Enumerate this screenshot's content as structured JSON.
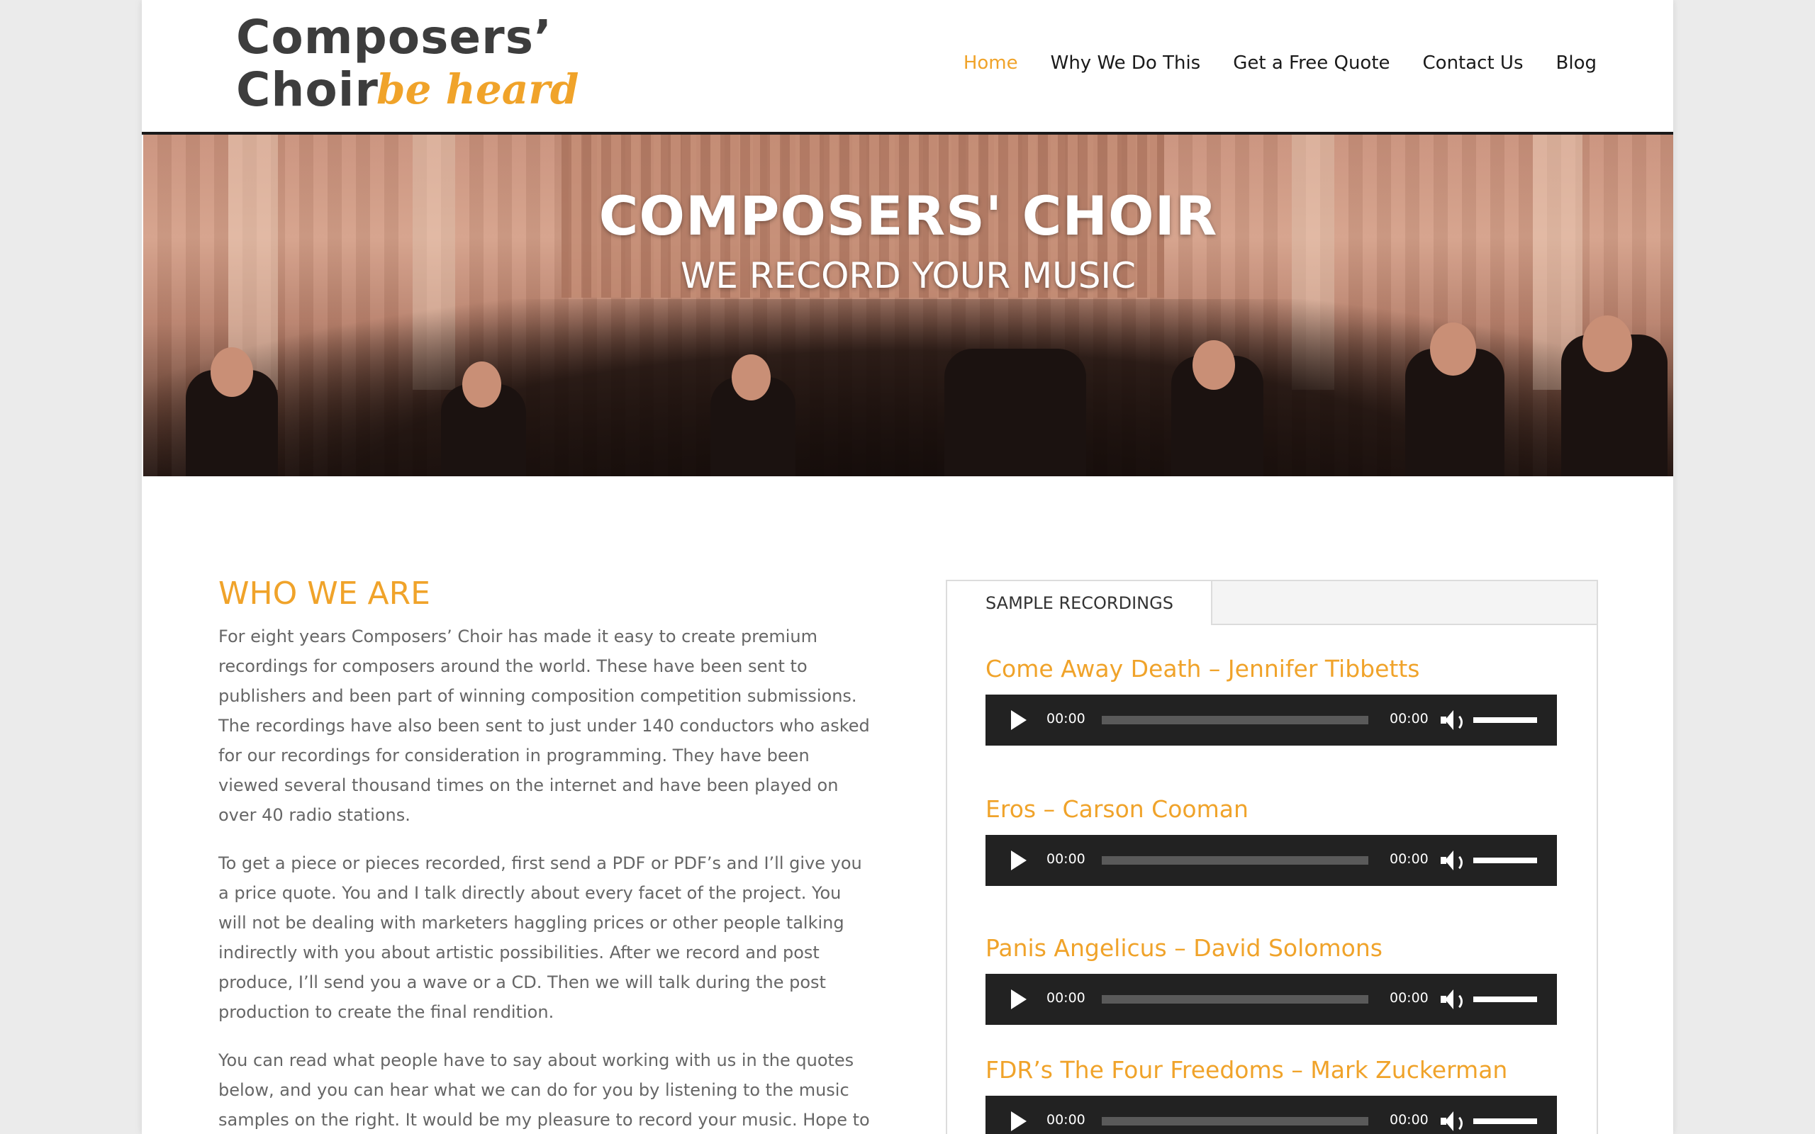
{
  "header": {
    "logo_line1": "Composers’",
    "logo_line2": "Choir",
    "logo_tagline": "be heard",
    "nav": [
      {
        "label": "Home",
        "active": true
      },
      {
        "label": "Why We Do This",
        "active": false
      },
      {
        "label": "Get a Free Quote",
        "active": false
      },
      {
        "label": "Contact Us",
        "active": false
      },
      {
        "label": "Blog",
        "active": false
      }
    ]
  },
  "hero": {
    "title": "COMPOSERS' CHOIR",
    "subtitle": "WE RECORD YOUR MUSIC"
  },
  "about": {
    "heading": "WHO WE ARE",
    "paragraphs": [
      "For eight years Composers’ Choir has made it easy to create premium recordings for composers around the world. These have been sent to publishers and been part of winning composition competition submissions. The recordings have also been sent to just under 140 conductors who asked for our recordings for consideration in programming. They have been viewed several thousand times on the internet and have been played on over 40 radio stations.",
      "To get a piece or pieces recorded, first send a PDF or PDF’s and I’ll give you a price quote. You and I talk directly about every facet of the project. You will not be dealing with marketers haggling prices or other people talking indirectly with you about artistic possibilities. After we record and post produce, I’ll send you a wave or a CD. Then we will talk during the post production to create the final rendition.",
      "You can read what people have to say about working with us in the quotes below, and you can hear what we can do for you by listening to the music samples on the right. It would be my pleasure to record your music. Hope to"
    ]
  },
  "samples": {
    "tab_label": "SAMPLE RECORDINGS",
    "tracks": [
      {
        "title": "Come Away Death – Jennifer Tibbetts",
        "current": "00:00",
        "duration": "00:00"
      },
      {
        "title": "Eros – Carson Cooman",
        "current": "00:00",
        "duration": "00:00"
      },
      {
        "title": "Panis Angelicus – David Solomons",
        "current": "00:00",
        "duration": "00:00"
      },
      {
        "title": "FDR’s The Four Freedoms – Mark Zuckerman",
        "current": "00:00",
        "duration": "00:00"
      }
    ]
  },
  "colors": {
    "accent": "#f0a32a",
    "text": "#666666",
    "player_bg": "#222222"
  }
}
